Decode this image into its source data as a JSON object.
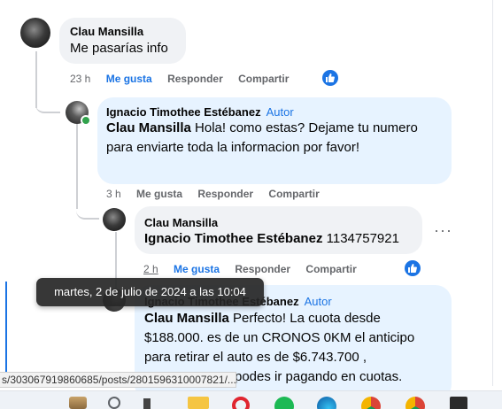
{
  "comments": [
    {
      "author": "Clau Mansilla",
      "text": "Me pasarías info",
      "time": "23 h",
      "like_label": "Me gusta",
      "reply_label": "Responder",
      "share_label": "Compartir"
    },
    {
      "author": "Ignacio Timothee Estébanez",
      "badge": "Autor",
      "mention": "Clau Mansilla",
      "text": "Hola! como estas? Dejame tu numero para enviarte toda la informacion por favor!",
      "time": "3 h",
      "like_label": "Me gusta",
      "reply_label": "Responder",
      "share_label": "Compartir"
    },
    {
      "author": "Clau Mansilla",
      "mention": "Ignacio Timothee Estébanez",
      "text": "1134757921",
      "time": "2 h",
      "like_label": "Me gusta",
      "reply_label": "Responder",
      "share_label": "Compartir",
      "more": "···"
    },
    {
      "author": "Ignacio Timothee Estébanez",
      "badge": "Autor",
      "mention": "Clau Mansilla",
      "text_line1": "Perfecto! La cuota desde",
      "text_line2": "$188.000. es de un CRONOS 0KM el anticipo",
      "text_line3": "para retirar el auto es de $6.743.700 ,",
      "text_line4": "podes ir pagando en cuotas."
    }
  ],
  "tooltip": "martes, 2 de julio de 2024 a las 10:04",
  "status_url": "s/303067919860685/posts/2801596310007821/...",
  "colors": {
    "accent": "#1b74e4",
    "bubble": "#f0f2f5",
    "author_bubble": "#e7f3ff",
    "online": "#31a24c"
  },
  "taskbar_icons": [
    "widgets-icon",
    "search-icon",
    "file-explorer-icon",
    "opera-icon",
    "spotify-icon",
    "edge-icon",
    "chrome-icon",
    "chrome-icon",
    "app-icon"
  ]
}
